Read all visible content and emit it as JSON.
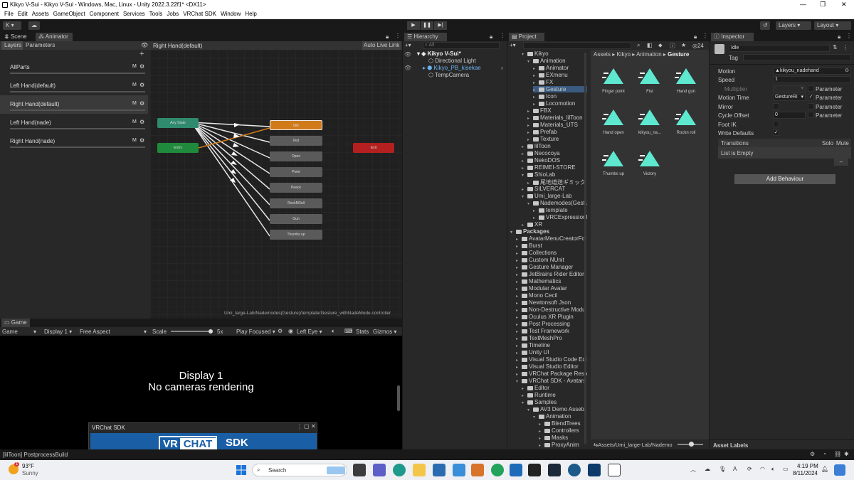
{
  "window": {
    "title": "Kikyo V-Sui - Kikyo V-Sui - Windows, Mac, Linux - Unity 2022.3.22f1* <DX11>"
  },
  "menu": [
    "File",
    "Edit",
    "Assets",
    "GameObject",
    "Component",
    "Services",
    "Tools",
    "Jobs",
    "VRChat SDK",
    "Window",
    "Help"
  ],
  "toolbar": {
    "account": "K",
    "layers": "Layers",
    "layout": "Layout"
  },
  "scene_tabs": {
    "scene": "Scene",
    "animator": "Animator"
  },
  "animator": {
    "layers_tab": "Layers",
    "params_tab": "Parameters",
    "breadcrumb": "Right Hand(default)",
    "auto_live": "Auto Live Link",
    "layers": [
      {
        "name": "AllParts",
        "m": "M"
      },
      {
        "name": "Left Hand(default)",
        "m": "M"
      },
      {
        "name": "Right Hand(default)",
        "m": "M"
      },
      {
        "name": "Left Hand(nade)",
        "m": "M"
      },
      {
        "name": "Right Hand(nade)",
        "m": "M"
      }
    ],
    "nodes": {
      "any": "Any State",
      "entry": "Entry",
      "exit": "Exit",
      "idle": "Idle",
      "fist": "Fist",
      "open": "Open",
      "point": "Point",
      "peace": "Peace",
      "rocknroll": "RockNRoll",
      "gun": "Gun",
      "thumbsup": "Thumbs up"
    },
    "path": "Umi_large-Lab/Nademodes(Gesture)/template/Gesture_withNadeMode.controller"
  },
  "game": {
    "tab": "Game",
    "mode": "Game",
    "display": "Display 1",
    "aspect": "Free Aspect",
    "scale_label": "Scale",
    "scale_value": "5x",
    "play_focused": "Play Focused",
    "eye": "Left Eye",
    "stats": "Stats",
    "gizmos": "Gizmos",
    "msg1": "Display 1",
    "msg2": "No cameras rendering"
  },
  "vrc": {
    "title": "VRChat SDK",
    "logo_vr": "VR",
    "logo_chat": "CHAT",
    "logo_sdk": "SDK"
  },
  "hierarchy": {
    "tab": "Hierarchy",
    "search": "All",
    "items": [
      "Kikyo V-Sui*",
      "Directional Light",
      "Kikyo_PB_kisekae",
      "TempCamera"
    ]
  },
  "project": {
    "tab": "Project",
    "count": "24",
    "tree": [
      "Kikyo",
      "Animation",
      "Animator",
      "EXmenu",
      "FX",
      "Gesture",
      "Icon",
      "Locomotion",
      "FBX",
      "Materials_lilToon",
      "Materials_UTS",
      "Prefab",
      "Texture",
      "lilToon",
      "Necocoya",
      "NekoDOS",
      "REIMEI-STORE",
      "ShioLab",
      "尾地道送ギミック",
      "SILVERCAT",
      "Umi_large-Lab",
      "Nademodes(Gesture)",
      "template",
      "VRCExpressionMe",
      "XR",
      "Packages",
      "AvatarMenuCreatorFor",
      "Burst",
      "Collections",
      "Custom NUnit",
      "Gesture Manager",
      "JetBrains Rider Editor",
      "Mathematics",
      "Modular Avatar",
      "Mono Cecil",
      "Newtonsoft Json",
      "Non-Destructive Modu",
      "Oculus XR Plugin",
      "Post Processing",
      "Test Framework",
      "TextMeshPro",
      "Timeline",
      "Unity UI",
      "Visual Studio Code Edit",
      "Visual Studio Editor",
      "VRChat Package Reso",
      "VRChat SDK - Avatars",
      "Editor",
      "Runtime",
      "Samples",
      "AV3 Demo Assets",
      "Animation",
      "BlendTrees",
      "Controllers",
      "Masks",
      "ProxyAnim"
    ],
    "breadcrumb": [
      "Assets",
      "Kikyo",
      "Animation",
      "Gesture"
    ],
    "assets": [
      "Finger point",
      "Fist",
      "Hand gun",
      "Hand open",
      "kikyou_na...",
      "Rockn roll",
      "Thumbs up",
      "Victory"
    ],
    "footer": "Assets/Umi_large-Lab/Nademo"
  },
  "inspector": {
    "tab": "Inspector",
    "name": "Idle",
    "tag": "Tag",
    "motion_label": "Motion",
    "motion_value": "kikyou_nadehand",
    "speed_label": "Speed",
    "speed_value": "1",
    "multiplier_label": "Multiplier",
    "parameter": "Parameter",
    "motion_time_label": "Motion Time",
    "motion_time_value": "GestureRi",
    "mirror_label": "Mirror",
    "cycle_label": "Cycle Offset",
    "cycle_value": "0",
    "footik_label": "Foot IK",
    "write_label": "Write Defaults",
    "transitions": "Transitions",
    "solo": "Solo",
    "mute": "Mute",
    "empty": "List is Empty",
    "add_behaviour": "Add Behaviour",
    "asset_labels": "Asset Labels"
  },
  "status": {
    "text": "[lilToon] PostprocessBuild"
  },
  "taskbar": {
    "temp": "93°F",
    "weather": "Sunny",
    "search": "Search",
    "time": "4:19 PM",
    "date": "8/11/2024",
    "badge": "1"
  },
  "colors": {
    "accent": "#4a90d9",
    "teal": "#5ee8d0",
    "orange": "#d07a1a",
    "green": "#1f8a3c",
    "red": "#b3201f"
  }
}
